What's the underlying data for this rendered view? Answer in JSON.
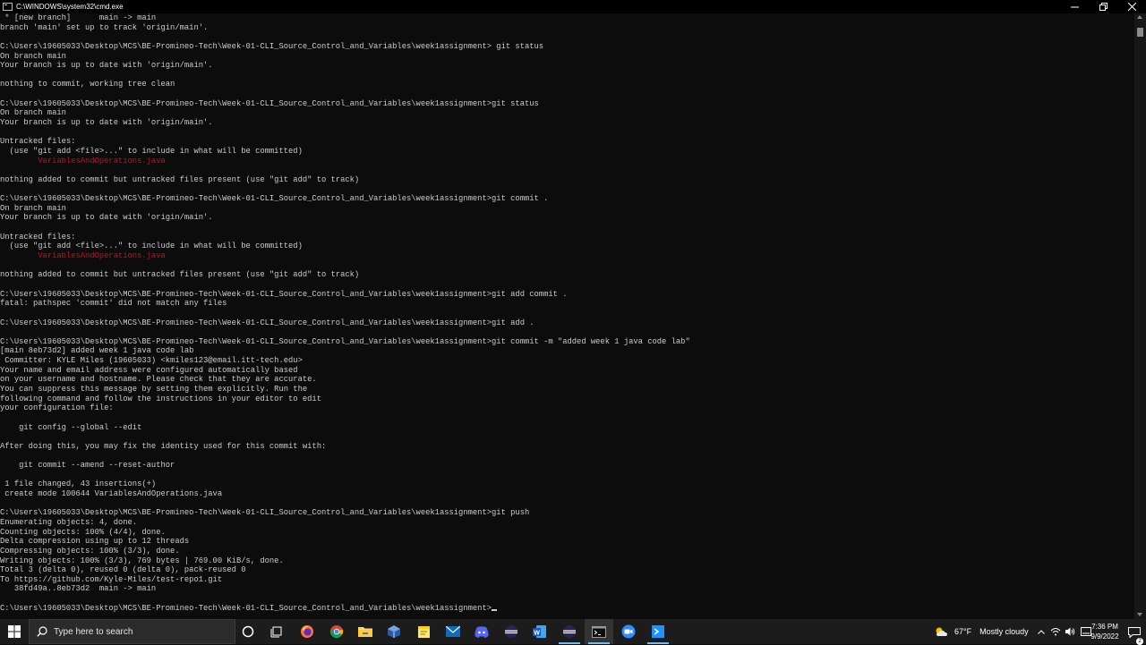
{
  "window": {
    "title": "C:\\WINDOWS\\system32\\cmd.exe",
    "controls": {
      "minimize": "minimize",
      "maximize": "maximize",
      "close": "close"
    }
  },
  "console": {
    "lines": [
      {
        "text": " * [new branch]      main -> main"
      },
      {
        "text": "branch 'main' set up to track 'origin/main'."
      },
      {
        "text": ""
      },
      {
        "text": "C:\\Users\\19605033\\Desktop\\MCS\\BE-Promineo-Tech\\Week-01-CLI_Source_Control_and_Variables\\week1assignment> git status"
      },
      {
        "text": "On branch main"
      },
      {
        "text": "Your branch is up to date with 'origin/main'."
      },
      {
        "text": ""
      },
      {
        "text": "nothing to commit, working tree clean"
      },
      {
        "text": ""
      },
      {
        "text": "C:\\Users\\19605033\\Desktop\\MCS\\BE-Promineo-Tech\\Week-01-CLI_Source_Control_and_Variables\\week1assignment>git status"
      },
      {
        "text": "On branch main"
      },
      {
        "text": "Your branch is up to date with 'origin/main'."
      },
      {
        "text": ""
      },
      {
        "text": "Untracked files:"
      },
      {
        "text": "  (use \"git add <file>...\" to include in what will be committed)"
      },
      {
        "text": "        VariablesAndOperations.java",
        "color": "red"
      },
      {
        "text": ""
      },
      {
        "text": "nothing added to commit but untracked files present (use \"git add\" to track)"
      },
      {
        "text": ""
      },
      {
        "text": "C:\\Users\\19605033\\Desktop\\MCS\\BE-Promineo-Tech\\Week-01-CLI_Source_Control_and_Variables\\week1assignment>git commit ."
      },
      {
        "text": "On branch main"
      },
      {
        "text": "Your branch is up to date with 'origin/main'."
      },
      {
        "text": ""
      },
      {
        "text": "Untracked files:"
      },
      {
        "text": "  (use \"git add <file>...\" to include in what will be committed)"
      },
      {
        "text": "        VariablesAndOperations.java",
        "color": "red"
      },
      {
        "text": ""
      },
      {
        "text": "nothing added to commit but untracked files present (use \"git add\" to track)"
      },
      {
        "text": ""
      },
      {
        "text": "C:\\Users\\19605033\\Desktop\\MCS\\BE-Promineo-Tech\\Week-01-CLI_Source_Control_and_Variables\\week1assignment>git add commit ."
      },
      {
        "text": "fatal: pathspec 'commit' did not match any files"
      },
      {
        "text": ""
      },
      {
        "text": "C:\\Users\\19605033\\Desktop\\MCS\\BE-Promineo-Tech\\Week-01-CLI_Source_Control_and_Variables\\week1assignment>git add ."
      },
      {
        "text": ""
      },
      {
        "text": "C:\\Users\\19605033\\Desktop\\MCS\\BE-Promineo-Tech\\Week-01-CLI_Source_Control_and_Variables\\week1assignment>git commit -m \"added week 1 java code lab\""
      },
      {
        "text": "[main 8eb73d2] added week 1 java code lab"
      },
      {
        "text": " Committer: KYLE Miles (19605033) <kmiles123@email.itt-tech.edu>"
      },
      {
        "text": "Your name and email address were configured automatically based"
      },
      {
        "text": "on your username and hostname. Please check that they are accurate."
      },
      {
        "text": "You can suppress this message by setting them explicitly. Run the"
      },
      {
        "text": "following command and follow the instructions in your editor to edit"
      },
      {
        "text": "your configuration file:"
      },
      {
        "text": ""
      },
      {
        "text": "    git config --global --edit"
      },
      {
        "text": ""
      },
      {
        "text": "After doing this, you may fix the identity used for this commit with:"
      },
      {
        "text": ""
      },
      {
        "text": "    git commit --amend --reset-author"
      },
      {
        "text": ""
      },
      {
        "text": " 1 file changed, 43 insertions(+)"
      },
      {
        "text": " create mode 100644 VariablesAndOperations.java"
      },
      {
        "text": ""
      },
      {
        "text": "C:\\Users\\19605033\\Desktop\\MCS\\BE-Promineo-Tech\\Week-01-CLI_Source_Control_and_Variables\\week1assignment>git push"
      },
      {
        "text": "Enumerating objects: 4, done."
      },
      {
        "text": "Counting objects: 100% (4/4), done."
      },
      {
        "text": "Delta compression using up to 12 threads"
      },
      {
        "text": "Compressing objects: 100% (3/3), done."
      },
      {
        "text": "Writing objects: 100% (3/3), 769 bytes | 769.00 KiB/s, done."
      },
      {
        "text": "Total 3 (delta 0), reused 0 (delta 0), pack-reused 0"
      },
      {
        "text": "To https://github.com/Kyle-Miles/test-repo1.git"
      },
      {
        "text": "   38fd49a..8eb73d2  main -> main"
      },
      {
        "text": ""
      },
      {
        "text": "C:\\Users\\19605033\\Desktop\\MCS\\BE-Promineo-Tech\\Week-01-CLI_Source_Control_and_Variables\\week1assignment>",
        "cursor": true
      }
    ]
  },
  "colors": {
    "console_bg": "#0c0c0c",
    "console_fg": "#cccccc",
    "error_red": "#c50f1f",
    "taskbar_bg": "#1c1c1c"
  },
  "taskbar": {
    "search_placeholder": "Type here to search",
    "pinned": [
      {
        "name": "cortana-icon"
      },
      {
        "name": "task-view-icon"
      },
      {
        "name": "firefox-icon"
      },
      {
        "name": "chrome-icon"
      },
      {
        "name": "file-explorer-icon"
      },
      {
        "name": "virtualbox-icon"
      },
      {
        "name": "sticky-notes-icon"
      },
      {
        "name": "mail-icon"
      },
      {
        "name": "discord-icon"
      },
      {
        "name": "eclipse-icon"
      },
      {
        "name": "word-icon"
      },
      {
        "name": "eclipse-2-icon"
      },
      {
        "name": "command-prompt-icon",
        "active": true
      },
      {
        "name": "zoom-icon"
      },
      {
        "name": "terminal-app-icon"
      }
    ],
    "weather": {
      "temp": "67°F",
      "condition": "Mostly cloudy"
    },
    "clock": {
      "time": "7:36 PM",
      "date": "9/9/2022"
    },
    "notifications_count": "2"
  }
}
